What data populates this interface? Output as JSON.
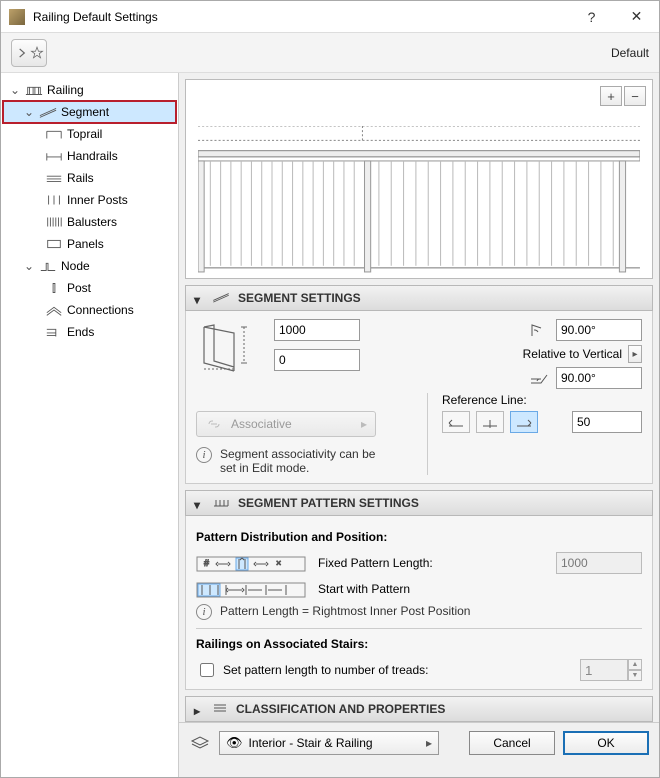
{
  "window": {
    "title": "Railing Default Settings"
  },
  "toolbar": {
    "default_label": "Default"
  },
  "tree": {
    "railing": "Railing",
    "segment": "Segment",
    "toprail": "Toprail",
    "handrails": "Handrails",
    "rails": "Rails",
    "inner_posts": "Inner Posts",
    "balusters": "Balusters",
    "panels": "Panels",
    "node": "Node",
    "post": "Post",
    "connections": "Connections",
    "ends": "Ends"
  },
  "panels": {
    "segment_settings": "SEGMENT SETTINGS",
    "segment_pattern": "SEGMENT PATTERN SETTINGS",
    "classification": "CLASSIFICATION AND PROPERTIES"
  },
  "segment": {
    "height": "1000",
    "offset": "0",
    "angle1": "90.00°",
    "angle2": "90.00°",
    "relative_label": "Relative to Vertical",
    "assoc_btn": "Associative",
    "assoc_info": "Segment associativity can be set in Edit mode.",
    "ref_line_label": "Reference Line:",
    "ref_offset": "50"
  },
  "pattern": {
    "dist_heading": "Pattern Distribution and Position:",
    "fixed_len_label": "Fixed Pattern Length:",
    "fixed_len_value": "1000",
    "start_with": "Start with Pattern",
    "length_info": "Pattern Length = Rightmost Inner Post Position",
    "stairs_heading": "Railings on Associated Stairs:",
    "treads_check": "Set pattern length to number of treads:",
    "treads_value": "1"
  },
  "footer": {
    "layer": "Interior - Stair & Railing",
    "cancel": "Cancel",
    "ok": "OK"
  }
}
